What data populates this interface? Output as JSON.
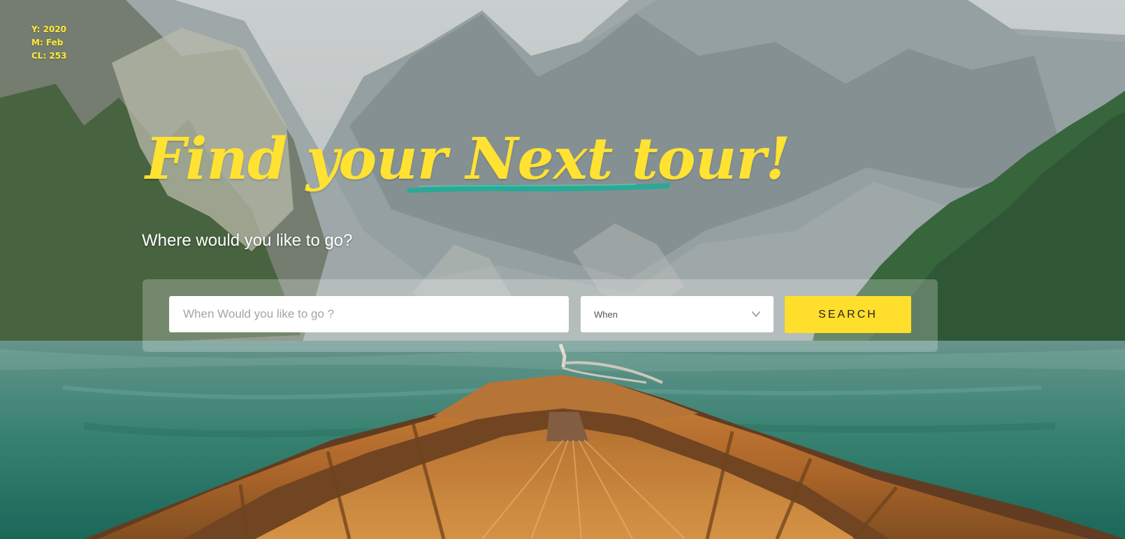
{
  "meta": {
    "year": "Y: 2020",
    "month": "M: Feb",
    "cl": "CL: 253"
  },
  "hero": {
    "headline_prefix": "Find your ",
    "headline_accent": "Next tour!",
    "subtitle": "Where would you like to go?"
  },
  "search": {
    "placeholder": "When Would you like to go ?",
    "when_value": "When",
    "button_label": "SEARCH"
  },
  "colors": {
    "headline": "#ffe232",
    "brush": "#2aa996",
    "button": "#ffdf2b"
  },
  "icons": {
    "dropdown": "chevron-down-icon"
  }
}
